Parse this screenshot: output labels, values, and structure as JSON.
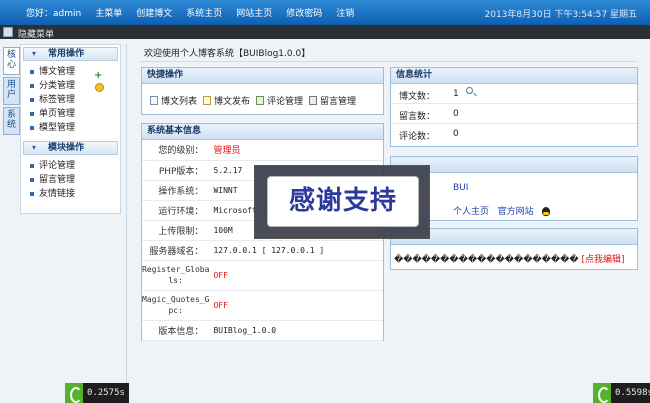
{
  "topbar": {
    "nav": [
      "您好：admin",
      "主菜单",
      "创建博文",
      "系统主页",
      "网站主页",
      "修改密码",
      "注销"
    ],
    "clock": "2013年8月30日 下午3:54:57 星期五"
  },
  "subbar": {
    "label": "隐藏菜单"
  },
  "vtabs": [
    "核心",
    "用户",
    "系统"
  ],
  "sidebar": {
    "groups": [
      {
        "title": "常用操作",
        "items": [
          "博文管理",
          "分类管理",
          "标签管理",
          "单页管理",
          "模型管理"
        ]
      },
      {
        "title": "模块操作",
        "items": [
          "评论管理",
          "留言管理",
          "友情链接"
        ]
      }
    ]
  },
  "welcome": "欢迎使用个人博客系统【BUIBlog1.0.0】",
  "quick": {
    "title": "快捷操作",
    "items": [
      "博文列表",
      "博文发布",
      "评论管理",
      "留言管理"
    ]
  },
  "sysinfo": {
    "title": "系统基本信息",
    "rows": [
      {
        "k": "您的级别：",
        "v": "管理员"
      },
      {
        "k": "PHP版本：",
        "v": "5.2.17"
      },
      {
        "k": "操作系统：",
        "v": "WINNT"
      },
      {
        "k": "运行环境：",
        "v": "Microsoft-II"
      },
      {
        "k": "上传限制：",
        "v": "100M"
      },
      {
        "k": "服务器域名：",
        "v": "127.0.0.1 [ 127.0.0.1 ]"
      },
      {
        "k1": "Register_Globa",
        "k2": "ls:",
        "v": "OFF"
      },
      {
        "k1": "Magic_Quotes_G",
        "k2": "pc:",
        "v": "OFF"
      },
      {
        "k": "版本信息：",
        "v": "BUIBlog_1.0.0"
      }
    ]
  },
  "stats": {
    "title": "信息统计",
    "rows": [
      {
        "k": "博文数：",
        "v": "1"
      },
      {
        "k": "留言数：",
        "v": "0"
      },
      {
        "k": "评论数：",
        "v": "0"
      }
    ]
  },
  "dev": {
    "name": "BUI",
    "links": [
      "个人主页",
      "官方网站"
    ]
  },
  "notice": {
    "text": "��������������������",
    "edit": "[点我编辑]"
  },
  "overlay": {
    "text": "感谢支持"
  },
  "timers": {
    "left": "0.2575s",
    "right": "0.5598s"
  }
}
